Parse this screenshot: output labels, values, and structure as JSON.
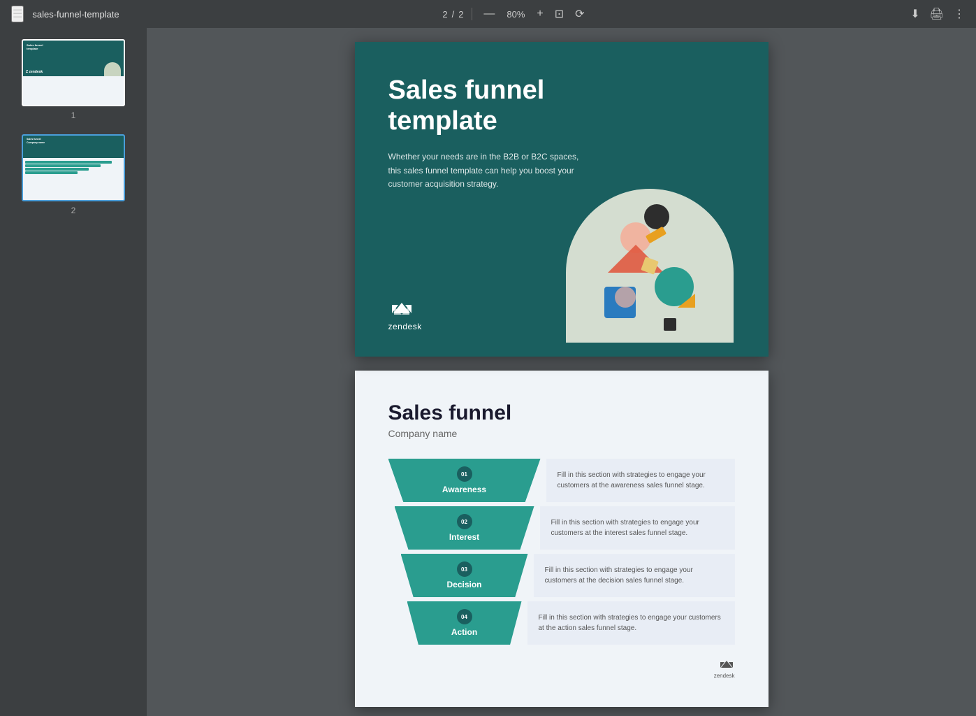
{
  "toolbar": {
    "menu_icon": "☰",
    "title": "sales-funnel-template",
    "page_current": "2",
    "page_total": "2",
    "zoom": "80%",
    "zoom_minus": "—",
    "zoom_plus": "+",
    "download_icon": "⬇",
    "print_icon": "🖨",
    "more_icon": "⋮"
  },
  "sidebar": {
    "thumbnails": [
      {
        "num": "1",
        "active": false
      },
      {
        "num": "2",
        "active": true
      }
    ]
  },
  "cover_slide": {
    "title": "Sales funnel template",
    "description": "Whether your needs are in the B2B or B2C spaces, this sales funnel template can help you boost your customer acquisition strategy.",
    "logo_name": "zendesk"
  },
  "content_slide": {
    "title": "Sales funnel",
    "company_label": "Company name",
    "footer_logo": "zendesk",
    "stages": [
      {
        "num": "01",
        "label": "Awareness",
        "description": "Fill in this section with strategies to engage your customers at the awareness sales funnel stage."
      },
      {
        "num": "02",
        "label": "Interest",
        "description": "Fill in this section with strategies to engage your customers at the interest sales funnel stage."
      },
      {
        "num": "03",
        "label": "Decision",
        "description": "Fill in this section with strategies to engage your customers at the decision sales funnel stage."
      },
      {
        "num": "04",
        "label": "Action",
        "description": "Fill in this section with strategies to engage your customers at the action sales funnel stage."
      }
    ]
  }
}
